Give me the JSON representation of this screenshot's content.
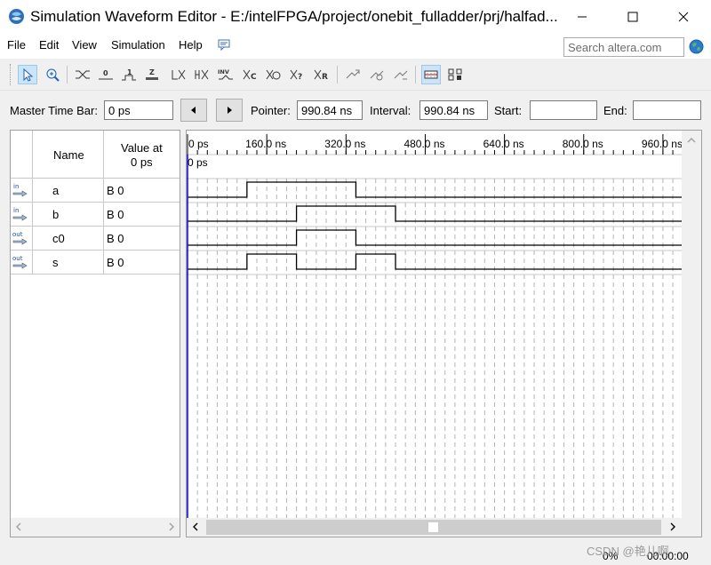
{
  "window": {
    "title": "Simulation Waveform Editor - E:/intelFPGA/project/onebit_fulladder/prj/halfad..."
  },
  "menu": [
    "File",
    "Edit",
    "View",
    "Simulation",
    "Help"
  ],
  "search": {
    "placeholder": "Search altera.com"
  },
  "toolbar": {
    "icons": [
      "selection-tool-icon",
      "zoom-tool-icon",
      "forcing-unknown-icon",
      "forcing-low-icon",
      "forcing-high-icon",
      "high-impedance-icon",
      "weak-low-icon",
      "weak-high-icon",
      "invert-icon",
      "count-value-icon",
      "clock-icon",
      "random-value-icon",
      "arbitrary-value-icon",
      "snap-to-grid-icon",
      "snap-to-transition-icon",
      "split-icon",
      "grid-settings-icon",
      "node-finder-icon"
    ],
    "labels": {
      "0": "0",
      "1": "1",
      "z": "Z",
      "inv": "INV"
    }
  },
  "timebar": {
    "master_label": "Master Time Bar:",
    "master_value": "0 ps",
    "pointer_label": "Pointer:",
    "pointer_value": "990.84 ns",
    "interval_label": "Interval:",
    "interval_value": "990.84 ns",
    "start_label": "Start:",
    "start_value": "",
    "end_label": "End:",
    "end_value": ""
  },
  "table": {
    "name_header": "Name",
    "value_header_line1": "Value at",
    "value_header_line2": "0 ps",
    "signals": [
      {
        "direction": "in",
        "name": "a",
        "value": "B 0"
      },
      {
        "direction": "in",
        "name": "b",
        "value": "B 0"
      },
      {
        "direction": "out",
        "name": "c0",
        "value": "B 0"
      },
      {
        "direction": "out",
        "name": "s",
        "value": "B 0"
      }
    ]
  },
  "waveform": {
    "time_unit": "ns",
    "ruler_labels": [
      "0 ps",
      "160.0 ns",
      "320.0 ns",
      "480.0 ns",
      "640.0 ns",
      "800.0 ns",
      "960.0 ns"
    ],
    "cursor_label": "0 ps",
    "grid_step_ns": 20,
    "view_end_ns": 1000,
    "signals": [
      {
        "name": "a",
        "high": [
          [
            120,
            340
          ]
        ]
      },
      {
        "name": "b",
        "high": [
          [
            220,
            420
          ]
        ]
      },
      {
        "name": "c0",
        "high": [
          [
            220,
            340
          ]
        ]
      },
      {
        "name": "s",
        "high": [
          [
            120,
            220
          ],
          [
            340,
            420
          ]
        ]
      }
    ]
  },
  "status": {
    "progress": "0%",
    "elapsed": "00:00:00"
  },
  "watermark": "CSDN @艳儿啊",
  "colors": {
    "cursor": "#0000c8",
    "wave": "#000000",
    "grid": "#b4b4b4"
  }
}
